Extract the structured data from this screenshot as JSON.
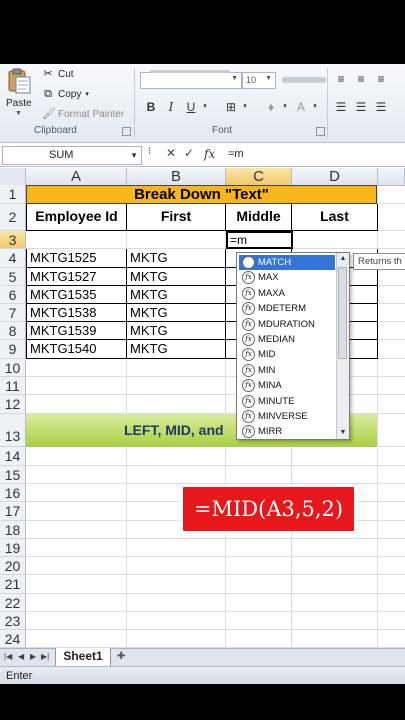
{
  "ribbon": {
    "paste_label": "Paste",
    "cut_label": "Cut",
    "copy_label": "Copy",
    "format_painter_label": "Format Painter",
    "clipboard_group": "Clipboard",
    "font_group": "Font",
    "font_size": "10",
    "bold": "B",
    "italic": "I",
    "underline": "U"
  },
  "formula_bar": {
    "name_box": "SUM",
    "cancel": "✕",
    "enter": "✓",
    "fx": "fx",
    "value": "=m"
  },
  "columns": [
    "A",
    "B",
    "C",
    "D"
  ],
  "rows": [
    "1",
    "2",
    "3",
    "4",
    "5",
    "6",
    "7",
    "8",
    "9",
    "10",
    "11",
    "12",
    "13",
    "14",
    "15",
    "16",
    "17",
    "18",
    "19",
    "20",
    "21",
    "22",
    "23",
    "24"
  ],
  "sheet": {
    "title": "Break Down \"Text\"",
    "headers": [
      "Employee Id",
      "First",
      "Middle",
      "Last"
    ],
    "data": [
      [
        "MKTG1525",
        "MKTG"
      ],
      [
        "MKTG1527",
        "MKTG"
      ],
      [
        "MKTG1535",
        "MKTG"
      ],
      [
        "MKTG1538",
        "MKTG"
      ],
      [
        "MKTG1539",
        "MKTG"
      ],
      [
        "MKTG1540",
        "MKTG"
      ]
    ],
    "active_cell_value": "=m",
    "banner": "LEFT, MID, and"
  },
  "autocomplete": {
    "items": [
      "MATCH",
      "MAX",
      "MAXA",
      "MDETERM",
      "MDURATION",
      "MEDIAN",
      "MID",
      "MIN",
      "MINA",
      "MINUTE",
      "MINVERSE",
      "MIRR"
    ],
    "selected": 0,
    "tooltip": "Returns th"
  },
  "overlay_text": "=MID(A3,5,2)",
  "tabs": {
    "sheet1": "Sheet1"
  },
  "status": {
    "mode": "Enter"
  },
  "colors": {
    "title_band": "#f7b61b",
    "banner_green": "#a8cf42",
    "overlay_red": "#e8171b",
    "selection_blue": "#3375d6"
  }
}
